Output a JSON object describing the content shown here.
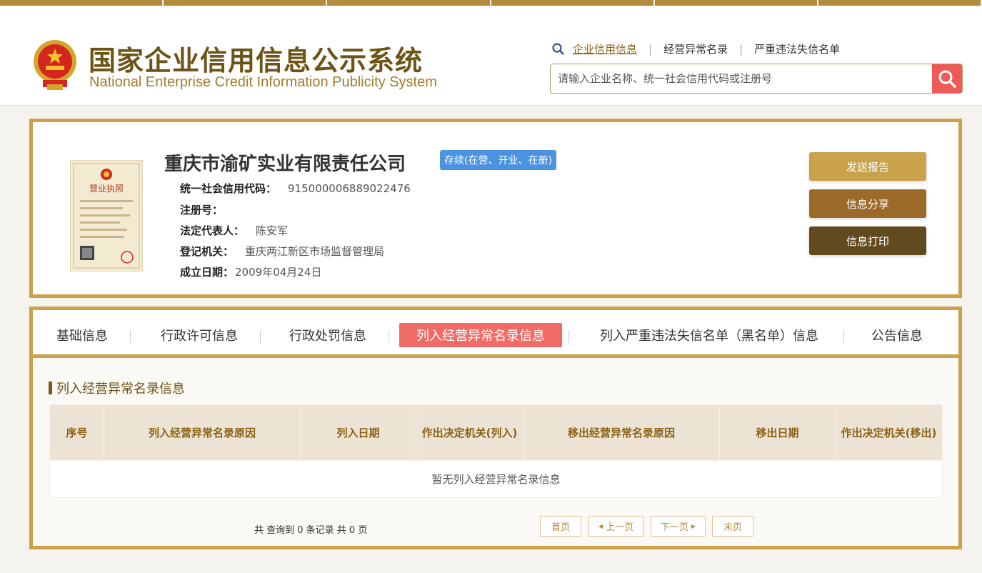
{
  "header": {
    "title_cn": "国家企业信用信息公示系统",
    "title_en": "National Enterprise Credit Information Publicity System",
    "links": [
      "企业信用信息",
      "经营异常名录",
      "严重违法失信名单"
    ],
    "search_placeholder": "请输入企业名称、统一社会信用代码或注册号",
    "icons": {
      "emblem": "national-emblem-icon",
      "search": "search-icon",
      "magnifier": "magnifier-icon"
    }
  },
  "company": {
    "name": "重庆市渝矿实业有限责任公司",
    "status": "存续(在营、开业、在册)",
    "fields": [
      {
        "label": "统一社会信用代码：",
        "value": "915000006889022476"
      },
      {
        "label": "注册号：",
        "value": ""
      },
      {
        "label": "法定代表人：",
        "value": "陈安军"
      },
      {
        "label": "登记机关：",
        "value": "重庆两江新区市场监督管理局"
      },
      {
        "label": "成立日期：",
        "value": "2009年04月24日"
      }
    ],
    "license_caption": "营业执照"
  },
  "actions": {
    "report": "发送报告",
    "share": "信息分享",
    "print": "信息打印"
  },
  "tabs": [
    "基础信息",
    "行政许可信息",
    "行政处罚信息",
    "列入经营异常名录信息",
    "列入严重违法失信名单（黑名单）信息",
    "公告信息"
  ],
  "active_tab": 3,
  "section": {
    "title": "列入经营异常名录信息",
    "columns": [
      "序号",
      "列入经营异常名录原因",
      "列入日期",
      "作出决定机关(列入)",
      "移出经营异常名录原因",
      "移出日期",
      "作出决定机关(移出)"
    ],
    "empty_text": "暂无列入经营异常名录信息"
  },
  "pager": {
    "summary": "共 查询到 0 条记录 共 0 页",
    "first": "首页",
    "prev": "上一页",
    "next": "下一页",
    "last": "末页"
  },
  "colors": {
    "gold": "#c9a24b",
    "brown": "#9b6a29",
    "dark_brown": "#624a1f",
    "tab_active": "#f06b66",
    "status_blue": "#4b93e0",
    "search_red": "#f05a56"
  }
}
